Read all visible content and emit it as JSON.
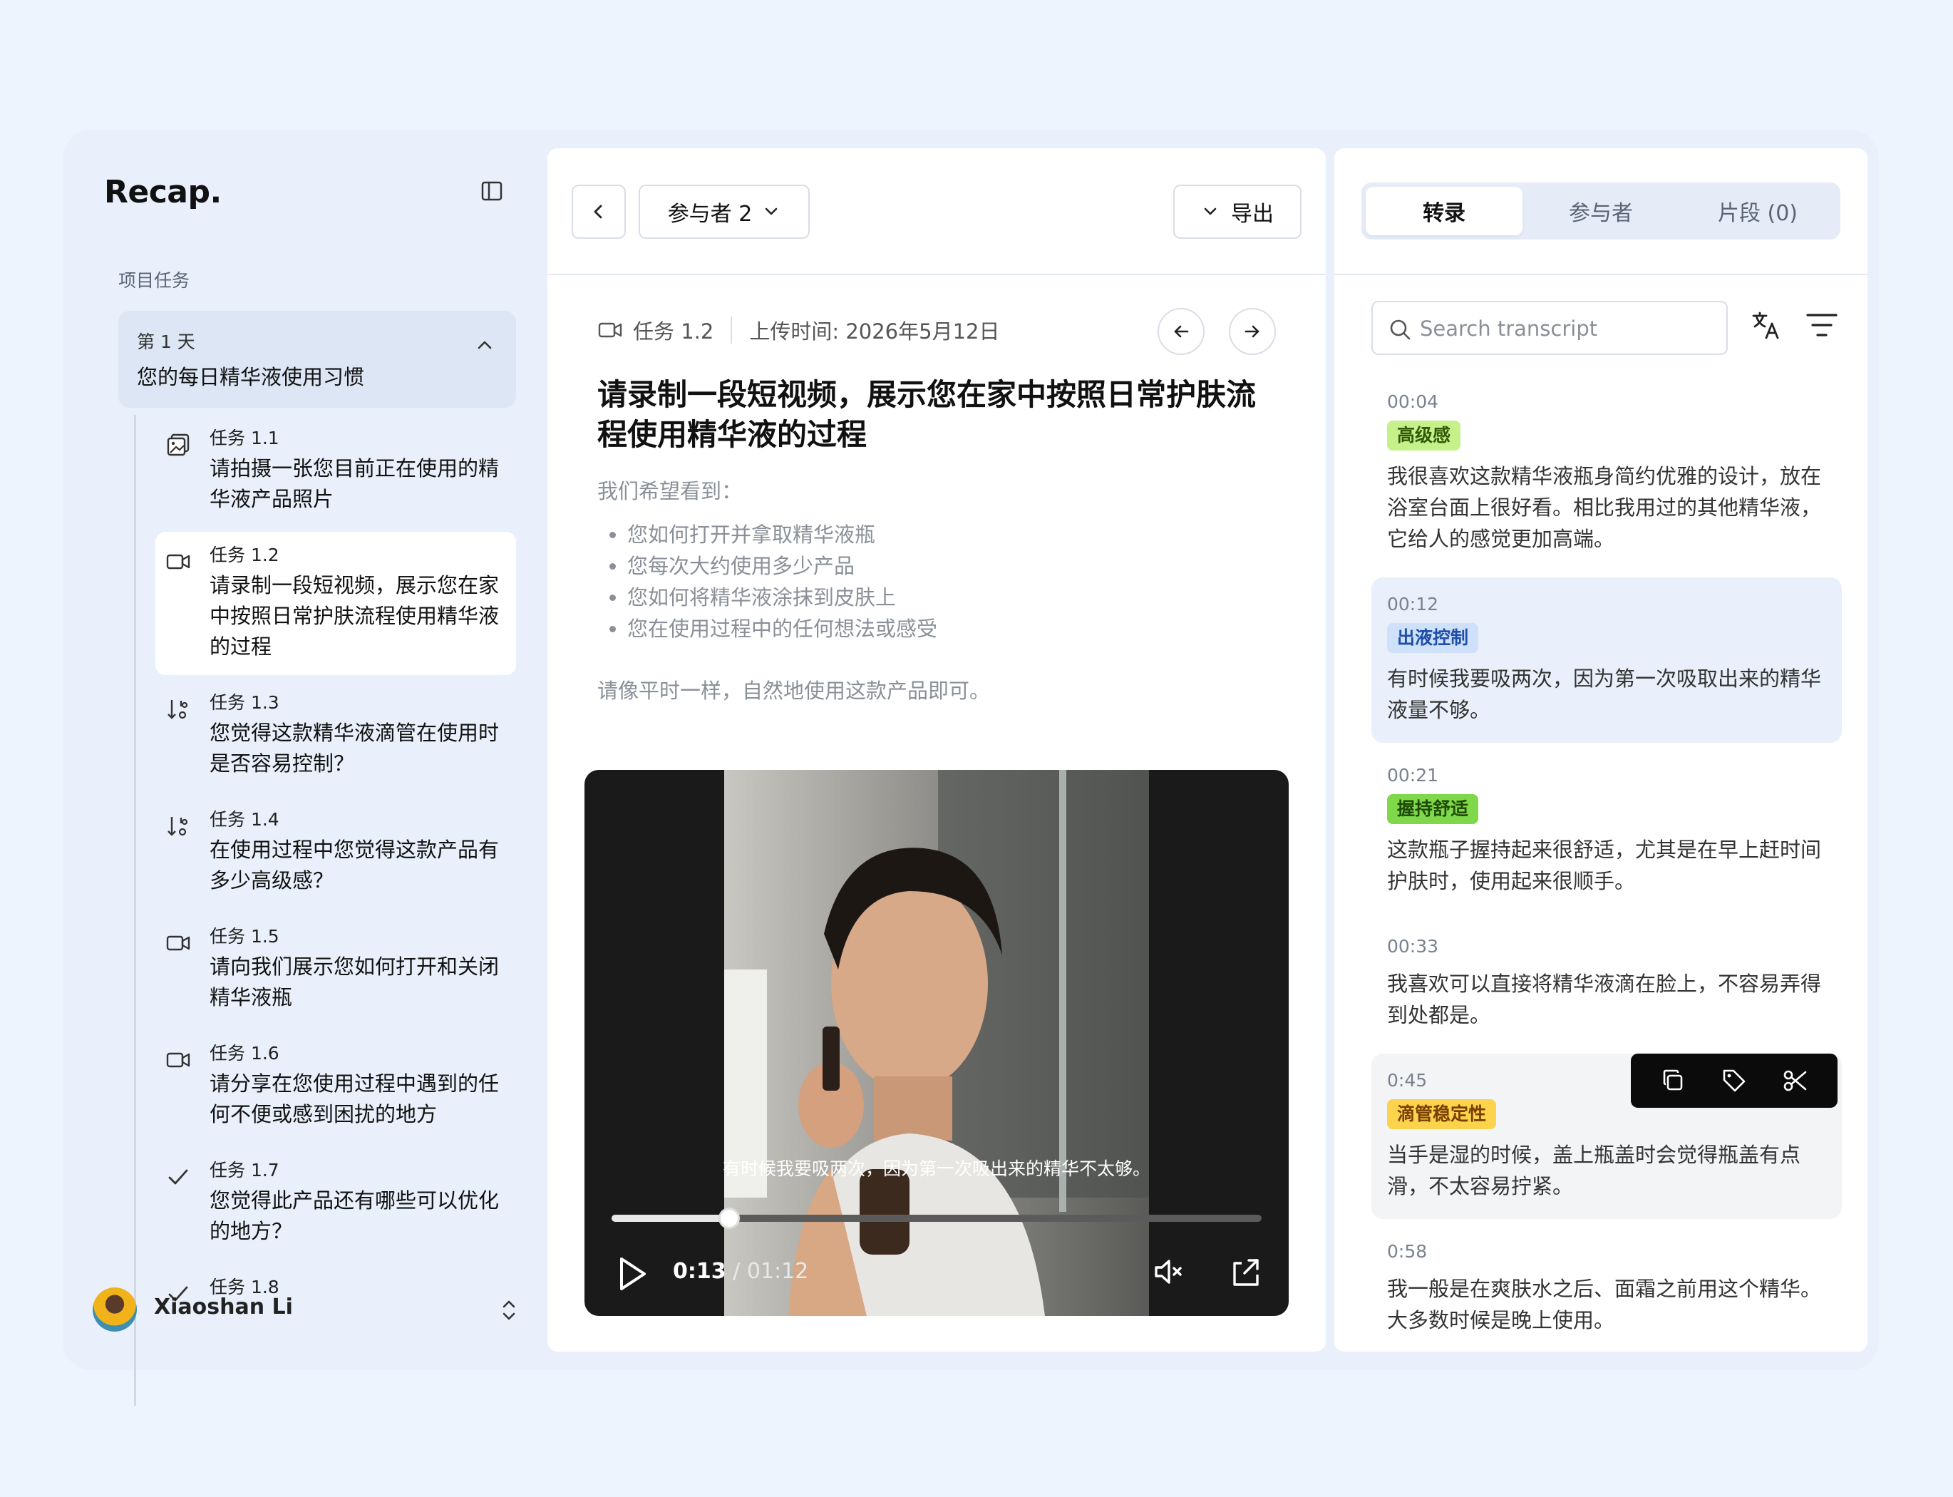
{
  "app": {
    "brand": "Recap."
  },
  "sidebar": {
    "section_label": "项目任务",
    "day": {
      "title": "第 1 天",
      "subtitle": "您的每日精华液使用习惯"
    },
    "tasks": [
      {
        "num": "任务 1.1",
        "text": "请拍摄一张您目前正在使用的精华液产品照片",
        "icon": "photo-icon"
      },
      {
        "num": "任务 1.2",
        "text": "请录制一段短视频，展示您在家中按照日常护肤流程使用精华液的过程",
        "icon": "video-icon"
      },
      {
        "num": "任务 1.3",
        "text": "您觉得这款精华液滴管在使用时是否容易控制？",
        "icon": "rating-icon"
      },
      {
        "num": "任务 1.4",
        "text": "在使用过程中您觉得这款产品有多少高级感？",
        "icon": "rating-icon"
      },
      {
        "num": "任务 1.5",
        "text": "请向我们展示您如何打开和关闭精华液瓶",
        "icon": "video-icon"
      },
      {
        "num": "任务 1.6",
        "text": "请分享在您使用过程中遇到的任何不便或感到困扰的地方",
        "icon": "video-icon"
      },
      {
        "num": "任务 1.7",
        "text": "您觉得此产品还有哪些可以优化的地方？",
        "icon": "check-icon"
      },
      {
        "num": "任务 1.8",
        "text": "",
        "icon": "check-icon"
      }
    ],
    "user": {
      "name": "Xiaoshan Li"
    }
  },
  "center": {
    "participant_label": "参与者 2",
    "export_label": "导出",
    "meta": {
      "task": "任务 1.2",
      "uploaded": "上传时间: 2026年5月12日"
    },
    "title": "请录制一段短视频，展示您在家中按照日常护肤流程使用精华液的过程",
    "intro": "我们希望看到：",
    "bullets": [
      "您如何打开并拿取精华液瓶",
      "您每次大约使用多少产品",
      "您如何将精华液涂抹到皮肤上",
      "您在使用过程中的任何想法或感受"
    ],
    "outro": "请像平时一样，自然地使用这款产品即可。",
    "video": {
      "caption": "有时候我要吸两次，因为第一次吸出来的精华不太够。",
      "current": "0:13",
      "separator": " / ",
      "duration": "01:12",
      "progress": 0.1806
    }
  },
  "right": {
    "tabs": [
      "转录",
      "参与者",
      "片段 (0)"
    ],
    "search_placeholder": "Search transcript",
    "entries": [
      {
        "time": "00:04",
        "tag": "高级感",
        "tag_bg": "#c5f08a",
        "tag_fg": "#2f5a06",
        "text": "我很喜欢这款精华液瓶身简约优雅的设计，放在浴室台面上很好看。相比我用过的其他精华液，它给人的感觉更加高端。"
      },
      {
        "time": "00:12",
        "tag": "出液控制",
        "tag_bg": "#cfe0fb",
        "tag_fg": "#1e4fa8",
        "text": "有时候我要吸两次，因为第一次吸取出来的精华液量不够。"
      },
      {
        "time": "00:21",
        "tag": "握持舒适",
        "tag_bg": "#7fd84a",
        "tag_fg": "#1f4a05",
        "text": "这款瓶子握持起来很舒适，尤其是在早上赶时间护肤时，使用起来很顺手。"
      },
      {
        "time": "00:33",
        "tag": "",
        "text": "我喜欢可以直接将精华液滴在脸上，不容易弄得到处都是。"
      },
      {
        "time": "0:45",
        "tag": "滴管稳定性",
        "tag_bg": "#fcd34d",
        "tag_fg": "#7a3f00",
        "text": "当手是湿的时候，盖上瓶盖时会觉得瓶盖有点滑，不太容易拧紧。"
      },
      {
        "time": "0:58",
        "tag": "",
        "text": "我一般是在爽肤水之后、面霜之前用这个精华。大多数时候是晚上使用。"
      }
    ]
  }
}
